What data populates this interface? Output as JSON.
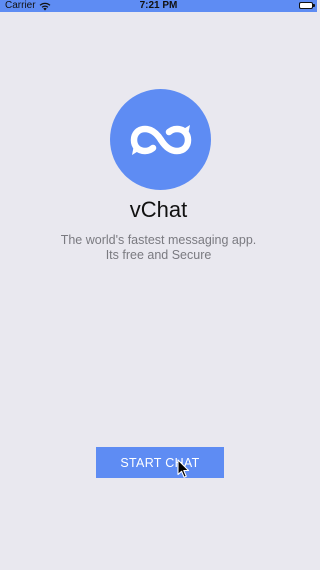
{
  "status_bar": {
    "carrier": "Carrier",
    "wifi_icon": "wifi-icon",
    "time": "7:21 PM",
    "battery_icon": "battery-icon"
  },
  "logo": {
    "icon": "infinity-chat-icon",
    "color": "#5e8cf3"
  },
  "app_name": "vChat",
  "tagline": {
    "line1": "The world's fastest messaging app.",
    "line2": "Its free and Secure"
  },
  "start_button": {
    "label": "START CHAT",
    "color": "#5e8cf3"
  },
  "colors": {
    "background": "#e9e8ef",
    "accent": "#5e8cf3"
  }
}
